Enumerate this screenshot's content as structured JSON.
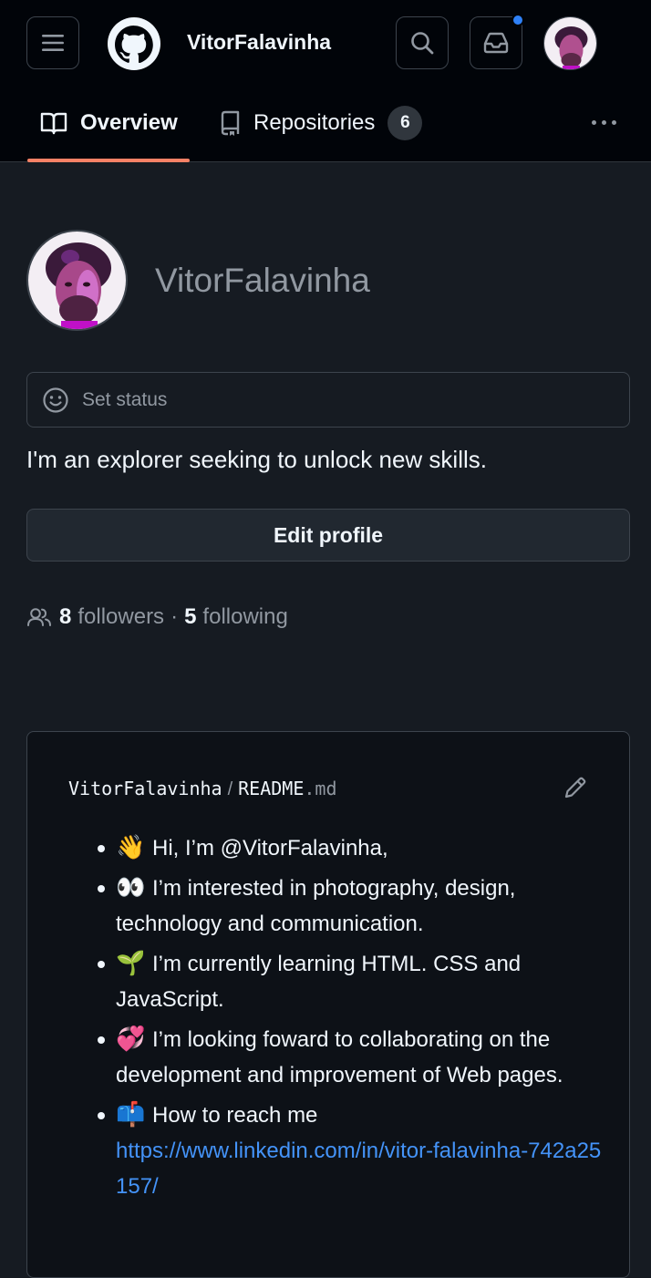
{
  "header": {
    "username": "VitorFalavinha",
    "menu_icon": "hamburger-icon",
    "logo_icon": "github-octocat-icon",
    "search_icon": "search-icon",
    "inbox_icon": "inbox-icon",
    "notification_dot_color": "#2f81f7"
  },
  "tabs": [
    {
      "label": "Overview",
      "icon": "book-icon",
      "selected": true
    },
    {
      "label": "Repositories",
      "icon": "repo-icon",
      "count": "6",
      "selected": false
    }
  ],
  "profile": {
    "login": "VitorFalavinha",
    "set_status_label": "Set status",
    "bio": "I'm an explorer seeking to unlock new skills.",
    "edit_profile_label": "Edit profile",
    "followers_count": "8",
    "followers_label": "followers",
    "separator": "·",
    "following_count": "5",
    "following_label": "following"
  },
  "readme": {
    "owner": "VitorFalavinha",
    "slash": "/",
    "file_name": "README",
    "file_ext": ".md",
    "items": [
      {
        "emoji": "👋",
        "text": "Hi, I’m @VitorFalavinha,"
      },
      {
        "emoji": "👀",
        "text": "I’m interested in photography, design, technology and communication."
      },
      {
        "emoji": "🌱",
        "text": "I’m currently learning HTML. CSS and JavaScript."
      },
      {
        "emoji": "💞",
        "text": "I’m looking foward to collaborating on the development and improvement of Web pages."
      },
      {
        "emoji": "📫",
        "text": "How to reach me",
        "link": "https://www.linkedin.com/in/vitor-falavinha-742a25157/"
      }
    ]
  },
  "colors": {
    "accent_underline": "#f78166",
    "link": "#4493f8"
  }
}
